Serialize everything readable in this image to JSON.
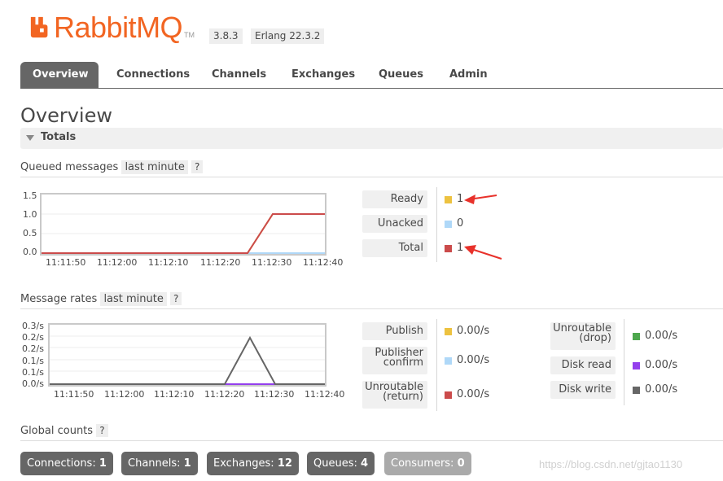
{
  "brand": {
    "name": "RabbitMQ",
    "tm": "TM",
    "version": "3.8.3",
    "erlang": "Erlang 22.3.2",
    "color": "#f26522"
  },
  "tabs": [
    {
      "label": "Overview",
      "active": true
    },
    {
      "label": "Connections"
    },
    {
      "label": "Channels"
    },
    {
      "label": "Exchanges"
    },
    {
      "label": "Queues"
    },
    {
      "label": "Admin"
    }
  ],
  "page_title": "Overview",
  "totals_label": "Totals",
  "queued": {
    "title": "Queued messages",
    "range": "last minute",
    "help": "?",
    "y_ticks": [
      "1.5",
      "1.0",
      "0.5",
      "0.0"
    ],
    "x_ticks": [
      "11:11:50",
      "11:12:00",
      "11:12:10",
      "11:12:20",
      "11:12:30",
      "11:12:40"
    ],
    "legend": [
      {
        "label": "Ready",
        "value": "1",
        "color": "#edc240"
      },
      {
        "label": "Unacked",
        "value": "0",
        "color": "#afd8f8"
      },
      {
        "label": "Total",
        "value": "1",
        "color": "#cb4b4b"
      }
    ]
  },
  "rates": {
    "title": "Message rates",
    "range": "last minute",
    "help": "?",
    "y_ticks": [
      "0.3/s",
      "0.2/s",
      "0.2/s",
      "0.1/s",
      "0.1/s",
      "0.0/s"
    ],
    "x_ticks": [
      "11:11:50",
      "11:12:00",
      "11:12:10",
      "11:12:20",
      "11:12:30",
      "11:12:40"
    ],
    "legend_left": [
      {
        "label": "Publish",
        "value": "0.00/s",
        "color": "#edc240"
      },
      {
        "label": "Publisher confirm",
        "value": "0.00/s",
        "color": "#afd8f8"
      },
      {
        "label": "Unroutable (return)",
        "value": "0.00/s",
        "color": "#cb4b4b"
      }
    ],
    "legend_right": [
      {
        "label": "Unroutable (drop)",
        "value": "0.00/s",
        "color": "#4da74d"
      },
      {
        "label": "Disk read",
        "value": "0.00/s",
        "color": "#9440ed"
      },
      {
        "label": "Disk write",
        "value": "0.00/s",
        "color": "#666666"
      }
    ]
  },
  "global": {
    "title": "Global counts",
    "help": "?",
    "counters": [
      {
        "label": "Connections:",
        "value": "1"
      },
      {
        "label": "Channels:",
        "value": "1"
      },
      {
        "label": "Exchanges:",
        "value": "12"
      },
      {
        "label": "Queues:",
        "value": "4"
      },
      {
        "label": "Consumers:",
        "value": "0"
      }
    ]
  },
  "watermark": "https://blog.csdn.net/gjtao1130",
  "chart_data": [
    {
      "type": "line",
      "x": [
        "11:11:50",
        "11:12:00",
        "11:12:10",
        "11:12:20",
        "11:12:30",
        "11:12:40"
      ],
      "ylim": [
        0,
        1.5
      ],
      "series": [
        {
          "name": "Ready",
          "color": "#edc240",
          "points": [
            [
              0,
              0
            ],
            [
              40,
              0
            ],
            [
              45,
              1
            ],
            [
              55,
              1
            ]
          ]
        },
        {
          "name": "Unacked",
          "color": "#afd8f8",
          "points": [
            [
              0,
              0
            ],
            [
              55,
              0
            ]
          ]
        },
        {
          "name": "Total",
          "color": "#cb4b4b",
          "points": [
            [
              0,
              0
            ],
            [
              40,
              0
            ],
            [
              45,
              1
            ],
            [
              55,
              1
            ]
          ]
        }
      ]
    },
    {
      "type": "line",
      "x": [
        "11:11:50",
        "11:12:00",
        "11:12:10",
        "11:12:20",
        "11:12:30",
        "11:12:40"
      ],
      "ylim": [
        0,
        0.3
      ],
      "series": [
        {
          "name": "Disk read",
          "color": "#9440ed",
          "points": [
            [
              35,
              0
            ],
            [
              45,
              0
            ]
          ]
        },
        {
          "name": "Disk write",
          "color": "#666666",
          "points": [
            [
              0,
              0
            ],
            [
              35,
              0
            ],
            [
              40,
              0.2
            ],
            [
              45,
              0
            ],
            [
              55,
              0
            ]
          ]
        }
      ]
    }
  ]
}
